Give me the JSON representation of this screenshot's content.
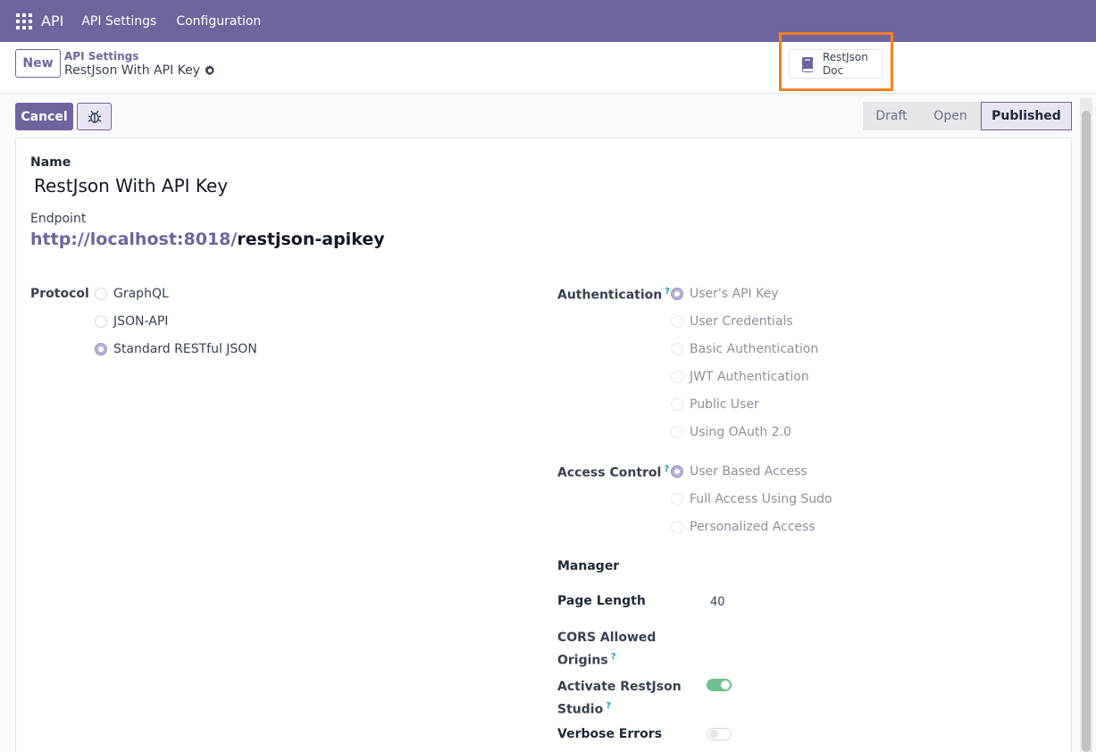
{
  "navbar": {
    "brand": "API",
    "menu": [
      "API Settings",
      "Configuration"
    ]
  },
  "control": {
    "new_label": "New",
    "breadcrumb": "API Settings",
    "record_name": "RestJson With API Key",
    "doc_button": "RestJson Doc"
  },
  "actions": {
    "cancel_label": "Cancel",
    "stages": [
      "Draft",
      "Open",
      "Published"
    ],
    "active_stage": "Published"
  },
  "form": {
    "name_label": "Name",
    "name_value": "RestJson With API Key",
    "endpoint_label": "Endpoint",
    "endpoint_base": "http://localhost:8018/",
    "endpoint_path": "restjson-apikey",
    "protocol_label": "Protocol",
    "protocol_options": [
      "GraphQL",
      "JSON-API",
      "Standard RESTful JSON"
    ],
    "protocol_selected": "Standard RESTful JSON",
    "authentication_label": "Authentication",
    "authentication_options": [
      "User's API Key",
      "User Credentials",
      "Basic Authentication",
      "JWT Authentication",
      "Public User",
      "Using OAuth 2.0"
    ],
    "authentication_selected": "User's API Key",
    "access_label": "Access Control",
    "access_options": [
      "User Based Access",
      "Full Access Using Sudo",
      "Personalized Access"
    ],
    "access_selected": "User Based Access",
    "manager_label": "Manager",
    "page_length_label": "Page Length",
    "page_length_value": "40",
    "cors_label_1": "CORS Allowed",
    "cors_label_2": "Origins",
    "studio_label_1": "Activate RestJson",
    "studio_label_2": "Studio",
    "studio_enabled": true,
    "verbose_label": "Verbose Errors",
    "verbose_enabled": false,
    "help_mark": "?"
  }
}
